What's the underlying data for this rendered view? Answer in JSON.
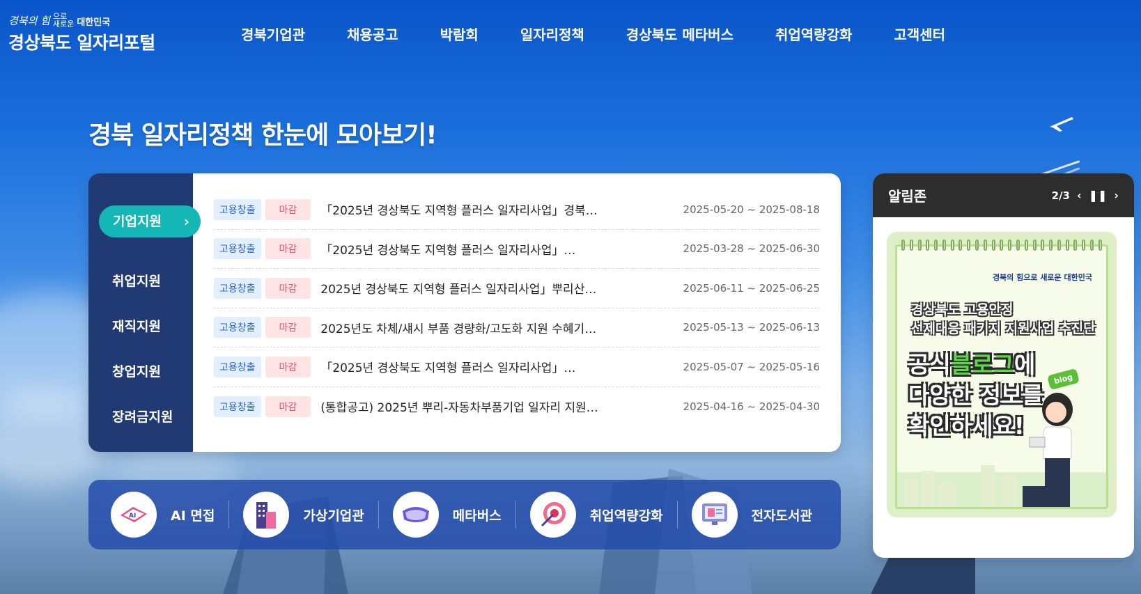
{
  "logo": {
    "slogan": "경북의 힘",
    "slogan_small_1": "으로",
    "slogan_small_2": "새로운",
    "slogan_country": "대한민국",
    "title": "경상북도 일자리포털"
  },
  "gnb": [
    "경북기업관",
    "채용공고",
    "박람회",
    "일자리정책",
    "경상북도 메타버스",
    "취업역량강화",
    "고객센터"
  ],
  "headline": "경북 일자리정책 한눈에 모아보기!",
  "policy": {
    "tabs": [
      "기업지원",
      "취업지원",
      "재직지원",
      "창업지원",
      "장려금지원"
    ],
    "active_tab": "기업지원",
    "rows": [
      {
        "category": "고용창출",
        "status": "마감",
        "title": "「2025년 경상북도 지역형 플러스 일자리사업」경북…",
        "date": "2025-05-20 ~ 2025-08-18"
      },
      {
        "category": "고용창출",
        "status": "마감",
        "title": "「2025년 경상북도 지역형 플러스 일자리사업」…",
        "date": "2025-03-28 ~ 2025-06-30"
      },
      {
        "category": "고용창출",
        "status": "마감",
        "title": "2025년 경상북도 지역형 플러스 일자리사업」뿌리산…",
        "date": "2025-06-11 ~ 2025-06-25"
      },
      {
        "category": "고용창출",
        "status": "마감",
        "title": "2025년도 차체/섀시 부품 경량화/고도화 지원 수혜기…",
        "date": "2025-05-13 ~ 2025-06-13"
      },
      {
        "category": "고용창출",
        "status": "마감",
        "title": "「2025년 경상북도 지역형 플러스 일자리사업」…",
        "date": "2025-05-07 ~ 2025-05-16"
      },
      {
        "category": "고용창출",
        "status": "마감",
        "title": "(통합공고) 2025년 뿌리-자동차부품기업 일자리 지원…",
        "date": "2025-04-16 ~ 2025-04-30"
      }
    ]
  },
  "quick": [
    {
      "label": "AI 면접",
      "icon": "ai-interview-icon"
    },
    {
      "label": "가상기업관",
      "icon": "building-icon"
    },
    {
      "label": "메타버스",
      "icon": "vr-headset-icon"
    },
    {
      "label": "취업역량강화",
      "icon": "target-icon"
    },
    {
      "label": "전자도서관",
      "icon": "monitor-icon"
    }
  ],
  "notice": {
    "title": "알림존",
    "pager": "2/3",
    "banner": {
      "logo_text": "경북의 힘으로 새로운 대한민국",
      "sub_line1": "경상북도 고용안정",
      "sub_line2": "선제대응 패키지 지원사업 추진단",
      "main_line1_a": "공식",
      "main_line1_b": "블로그",
      "main_line1_c": "에",
      "main_line2": "다양한 정보를",
      "main_line3": "확인하세요!",
      "blog_tag": "blog"
    }
  },
  "colors": {
    "tab_bg": "#223a73",
    "active_tab": "#14b6b6",
    "quick_bar": "#244caa",
    "notice_head": "#2d2d2d"
  }
}
